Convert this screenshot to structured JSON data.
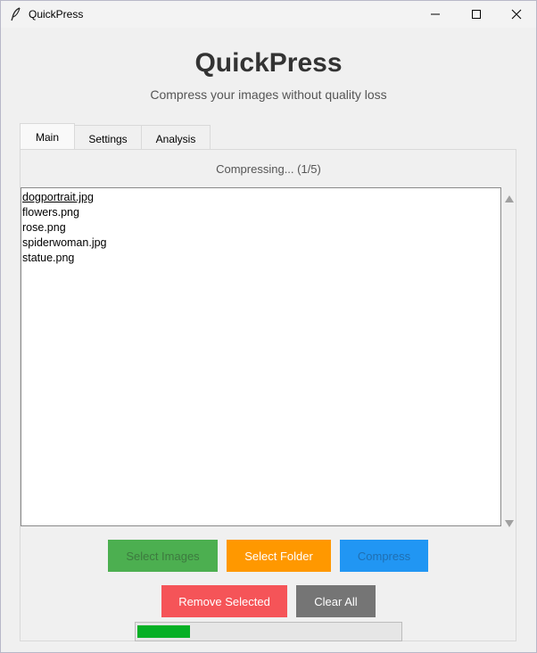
{
  "window": {
    "title": "QuickPress"
  },
  "header": {
    "title": "QuickPress",
    "subtitle": "Compress your images without quality loss"
  },
  "tabs": [
    {
      "label": "Main",
      "active": true
    },
    {
      "label": "Settings",
      "active": false
    },
    {
      "label": "Analysis",
      "active": false
    }
  ],
  "main": {
    "status": "Compressing... (1/5)",
    "files": [
      "dogportrait.jpg",
      "flowers.png",
      "rose.png",
      "spiderwoman.jpg",
      "statue.png"
    ],
    "selected_index": 0
  },
  "buttons": {
    "select_images": "Select Images",
    "select_folder": "Select Folder",
    "compress": "Compress",
    "remove_selected": "Remove Selected",
    "clear_all": "Clear All"
  },
  "progress": {
    "fraction": 0.2
  },
  "colors": {
    "select_images": "#4caf50",
    "select_folder": "#ff9800",
    "compress": "#2196f3",
    "remove_selected": "#f55458",
    "clear_all": "#757575",
    "progress_fill": "#06b025"
  },
  "icons": {
    "app": "feather-icon",
    "minimize": "minimize-icon",
    "maximize": "maximize-icon",
    "close": "close-icon",
    "scroll_up": "scroll-up-arrow-icon",
    "scroll_down": "scroll-down-arrow-icon"
  }
}
